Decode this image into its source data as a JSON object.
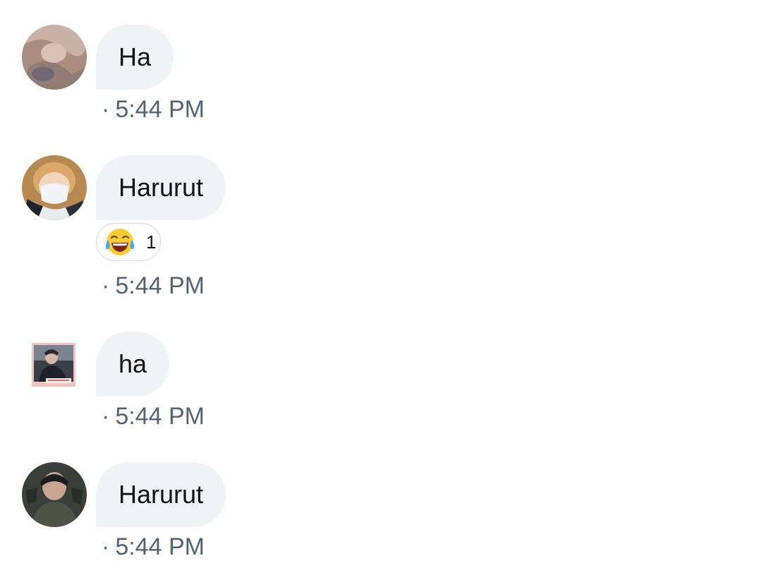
{
  "messages": [
    {
      "text": "Ha",
      "time": "5:44 PM",
      "avatar": "avatar-1"
    },
    {
      "text": "Harurut",
      "time": "5:44 PM",
      "avatar": "avatar-2",
      "reaction": {
        "emoji": "face-with-tears-of-joy",
        "count": "1"
      }
    },
    {
      "text": "ha",
      "time": "5:44 PM",
      "avatar": "avatar-3"
    },
    {
      "text": "Harurut",
      "time": "5:44 PM",
      "avatar": "avatar-4"
    }
  ],
  "separator": "·",
  "colors": {
    "bubble_bg": "#eff3f4",
    "text": "#0f1419",
    "meta": "#536471",
    "reaction_border": "#cfd9de"
  }
}
